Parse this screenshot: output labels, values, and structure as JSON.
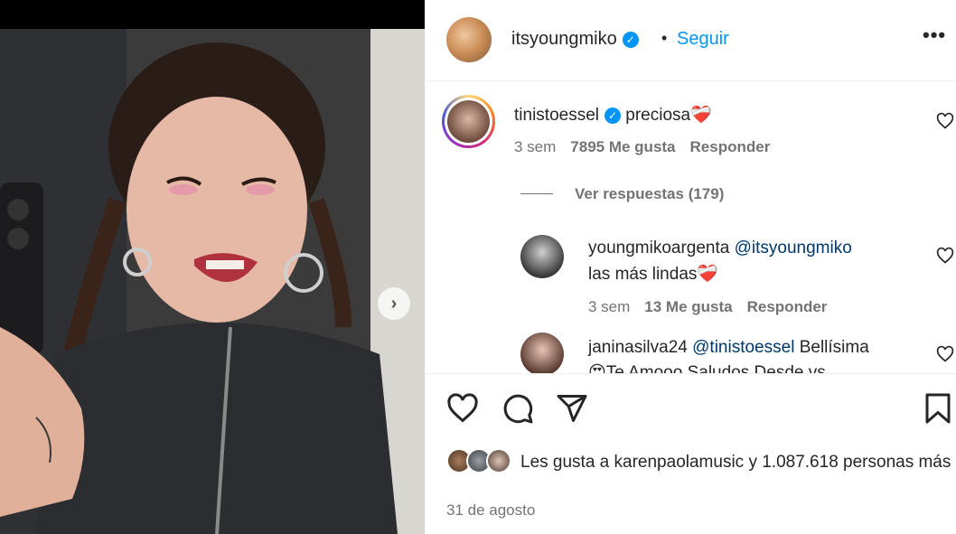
{
  "post": {
    "author": "itsyoungmiko",
    "follow_label": "Seguir",
    "dot": "•",
    "more": "•••",
    "next_arrow": "›",
    "date": "31 de agosto",
    "likes": {
      "prefix": "Les gusta a ",
      "user": "karenpaolamusic",
      "middle": " y ",
      "count": "1.087.618 personas",
      "suffix": "más"
    }
  },
  "comments": [
    {
      "user": "tinistoessel",
      "verified": true,
      "text": "preciosa",
      "emoji": "❤️‍🩹",
      "time": "3 sem",
      "likes": "7895 Me gusta",
      "reply": "Responder",
      "view_replies": "Ver respuestas (179)"
    },
    {
      "user": "youngmikoargenta",
      "mention": "@itsyoungmiko",
      "text": "las más lindas",
      "emoji": "❤️‍🩹",
      "time": "3 sem",
      "likes": "13 Me gusta",
      "reply": "Responder"
    },
    {
      "user": "janinasilva24",
      "mention": "@tinistoessel",
      "text": "Bellísima",
      "text2": "😍Te Amooo Saludos Desde vs"
    }
  ],
  "icons": {
    "verified": "✓",
    "like": "heart-icon",
    "comment": "comment-icon",
    "share": "share-icon",
    "save": "bookmark-icon"
  }
}
